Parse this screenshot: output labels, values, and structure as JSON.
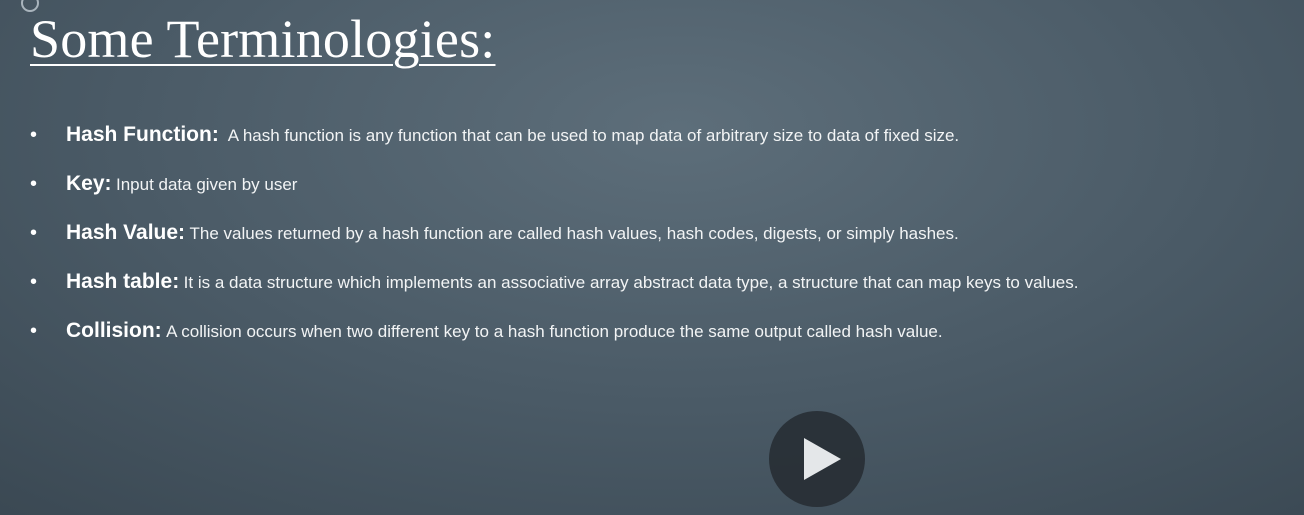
{
  "slide": {
    "title": "Some Terminologies:",
    "bullet_symbol": "•",
    "terms": [
      {
        "name": "Hash Function:",
        "definition": "A hash function is any function that can be used to map data of arbitrary size to data of fixed size."
      },
      {
        "name": "Key:",
        "definition": "Input data given by user"
      },
      {
        "name": "Hash Value:",
        "definition": "The values returned by a hash function are called hash values, hash codes, digests, or simply hashes."
      },
      {
        "name": "Hash table:",
        "definition": "It is a data structure which implements an associative array abstract data type, a structure that can map keys to values."
      },
      {
        "name": "Collision:",
        "definition": "A collision occurs when two different key to a hash function produce the same output called hash value."
      }
    ]
  },
  "player": {
    "play_icon": "play-icon",
    "corner_icon": "circle-icon"
  },
  "colors": {
    "background_center": "#5d6e7a",
    "background_edge": "#34414b",
    "text": "#ffffff",
    "play_button": "#282f35"
  }
}
